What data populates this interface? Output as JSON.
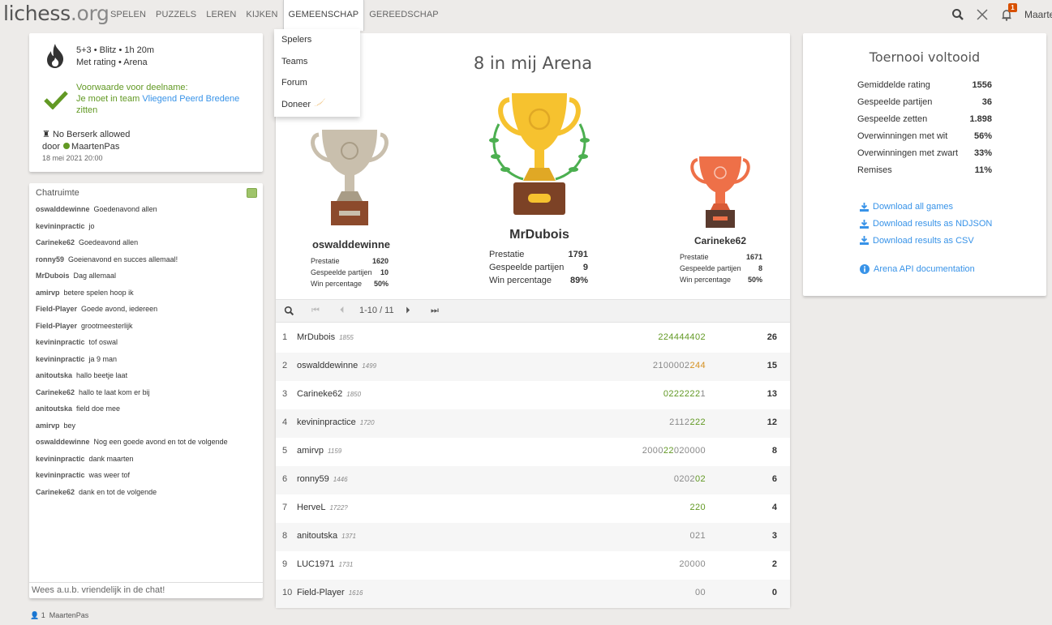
{
  "header": {
    "logo_main": "lichess",
    "logo_suffix": ".org",
    "username": "Maarten",
    "nav": [
      {
        "label": "SPELEN"
      },
      {
        "label": "PUZZELS"
      },
      {
        "label": "LEREN"
      },
      {
        "label": "KIJKEN"
      },
      {
        "label": "GEMEENSCHAP",
        "active": true
      },
      {
        "label": "GEREEDSCHAP"
      }
    ],
    "notification_count": "1",
    "icons": [
      "search-icon",
      "swords-icon",
      "bell-icon"
    ]
  },
  "dropdown": {
    "items": [
      "Spelers",
      "Teams",
      "Forum",
      "Doneer"
    ]
  },
  "info": {
    "line1": "5+3 • Blitz • 1h 20m",
    "line2": "Met rating • Arena",
    "condition_title": "Voorwaarde voor deelname:",
    "condition_text": "Je moet in team",
    "condition_team": "Vliegend Peerd Bredene",
    "condition_suffix": "zitten",
    "berserk": "No Berserk allowed",
    "by": "door",
    "creator": "MaartenPas",
    "date": "18 mei 2021 20:00"
  },
  "chat": {
    "title": "Chatruimte",
    "placeholder": "Wees a.u.b. vriendelijk in de chat!",
    "messages": [
      {
        "user": "oswalddewinne",
        "text": "Goedenavond allen"
      },
      {
        "user": "kevininpractic",
        "text": "jo"
      },
      {
        "user": "Carineke62",
        "text": "Goedeavond allen"
      },
      {
        "user": "ronny59",
        "text": "Goeienavond en succes allemaal!"
      },
      {
        "user": "MrDubois",
        "text": "Dag allemaal"
      },
      {
        "user": "amirvp",
        "text": "betere spelen hoop ik"
      },
      {
        "user": "Field-Player",
        "text": "Goede avond, iedereen"
      },
      {
        "user": "Field-Player",
        "text": "grootmeesterlijk"
      },
      {
        "user": "kevininpractic",
        "text": "tof oswal"
      },
      {
        "user": "kevininpractic",
        "text": "ja 9 man"
      },
      {
        "user": "anitoutska",
        "text": "hallo beetje laat"
      },
      {
        "user": "Carineke62",
        "text": "hallo te laat kom er bij"
      },
      {
        "user": "anitoutska",
        "text": "field doe mee"
      },
      {
        "user": "amirvp",
        "text": "bey"
      },
      {
        "user": "oswalddewinne",
        "text": "Nog een goede avond en tot de volgende"
      },
      {
        "user": "kevininpractic",
        "text": "dank maarten"
      },
      {
        "user": "kevininpractic",
        "text": "was weer tof"
      },
      {
        "user": "Carineke62",
        "text": "dank en tot de volgende"
      }
    ]
  },
  "online": {
    "count": "1",
    "user": "MaartenPas"
  },
  "tournament": {
    "title": "8 in mij Arena",
    "podium": [
      {
        "place": 2,
        "name": "oswalddewinne",
        "stats": [
          [
            "Prestatie",
            "1620"
          ],
          [
            "Gespeelde partijen",
            "10"
          ],
          [
            "Win percentage",
            "50%"
          ]
        ]
      },
      {
        "place": 1,
        "name": "MrDubois",
        "stats": [
          [
            "Prestatie",
            "1791"
          ],
          [
            "Gespeelde partijen",
            "9"
          ],
          [
            "Win percentage",
            "89%"
          ]
        ]
      },
      {
        "place": 3,
        "name": "Carineke62",
        "stats": [
          [
            "Prestatie",
            "1671"
          ],
          [
            "Gespeelde partijen",
            "8"
          ],
          [
            "Win percentage",
            "50%"
          ]
        ]
      }
    ],
    "pager": "1-10 / 11",
    "standings": [
      {
        "rank": "1",
        "name": "MrDubois",
        "rating": "1855",
        "sheet": [
          [
            "224444402",
            "g"
          ]
        ],
        "score": "26"
      },
      {
        "rank": "2",
        "name": "oswalddewinne",
        "rating": "1499",
        "sheet": [
          [
            "2100002",
            "n"
          ],
          [
            "244",
            "o"
          ]
        ],
        "score": "15"
      },
      {
        "rank": "3",
        "name": "Carineke62",
        "rating": "1850",
        "sheet": [
          [
            "0222222",
            "g"
          ],
          [
            "1",
            "n"
          ]
        ],
        "score": "13"
      },
      {
        "rank": "4",
        "name": "kevininpractice",
        "rating": "1720",
        "sheet": [
          [
            "2112",
            "n"
          ],
          [
            "222",
            "g"
          ]
        ],
        "score": "12"
      },
      {
        "rank": "5",
        "name": "amirvp",
        "rating": "1159",
        "sheet": [
          [
            "2000",
            "n"
          ],
          [
            "22",
            "g"
          ],
          [
            "020000",
            "n"
          ]
        ],
        "score": "8"
      },
      {
        "rank": "6",
        "name": "ronny59",
        "rating": "1446",
        "sheet": [
          [
            "0202",
            "n"
          ],
          [
            "02",
            "g"
          ]
        ],
        "score": "6"
      },
      {
        "rank": "7",
        "name": "HerveL",
        "rating": "1722?",
        "sheet": [
          [
            "220",
            "g"
          ]
        ],
        "score": "4"
      },
      {
        "rank": "8",
        "name": "anitoutska",
        "rating": "1371",
        "sheet": [
          [
            "021",
            "n"
          ]
        ],
        "score": "3"
      },
      {
        "rank": "9",
        "name": "LUC1971",
        "rating": "1731",
        "sheet": [
          [
            "20000",
            "n"
          ]
        ],
        "score": "2"
      },
      {
        "rank": "10",
        "name": "Field-Player",
        "rating": "1616",
        "sheet": [
          [
            "00",
            "n"
          ]
        ],
        "score": "0"
      }
    ]
  },
  "summary": {
    "title": "Toernooi voltooid",
    "rows": [
      [
        "Gemiddelde rating",
        "1556"
      ],
      [
        "Gespeelde partijen",
        "36"
      ],
      [
        "Gespeelde zetten",
        "1.898"
      ],
      [
        "Overwinningen met wit",
        "56%"
      ],
      [
        "Overwinningen met zwart",
        "33%"
      ],
      [
        "Remises",
        "11%"
      ]
    ],
    "downloads": [
      "Download all games",
      "Download results as NDJSON",
      "Download results as CSV"
    ],
    "api": "Arena API documentation"
  },
  "colors": {
    "green": "#629924",
    "orange": "#d59020",
    "link": "#3893e8",
    "badge": "#d85000",
    "gold": "#f6c22f",
    "silver": "#c9bfad",
    "bronze": "#ee7048"
  }
}
